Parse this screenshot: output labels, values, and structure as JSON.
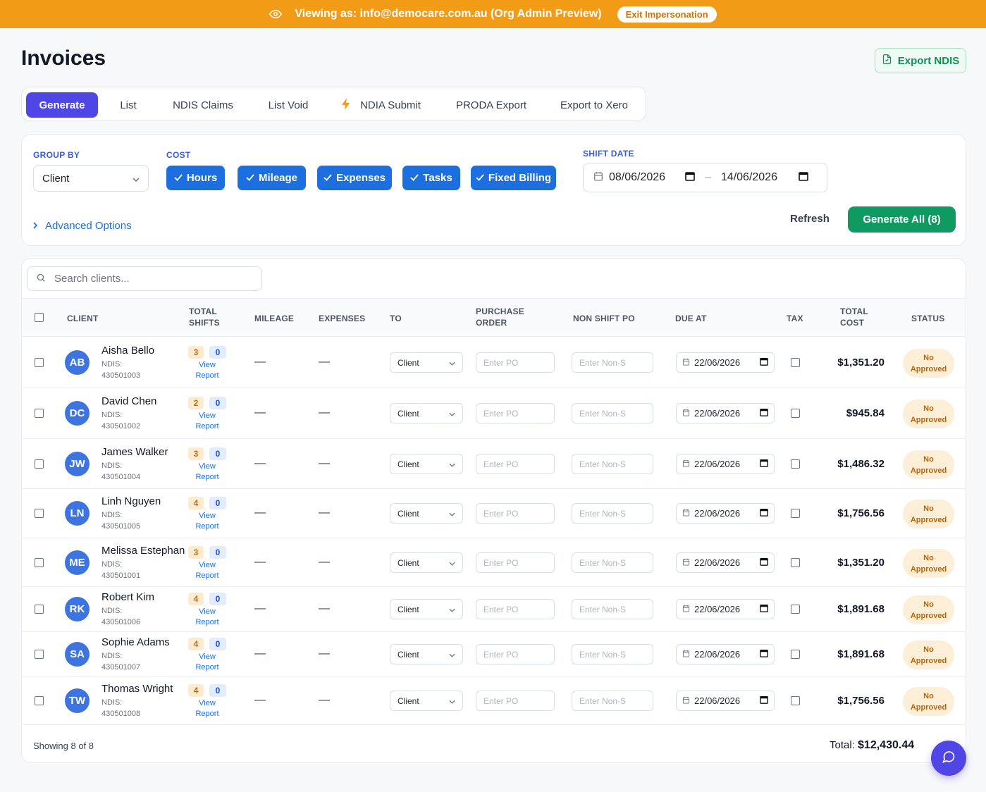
{
  "banner": {
    "text": "Viewing as: info@democare.com.au (Org Admin Preview)",
    "exit_label": "Exit Impersonation",
    "icon": "eye-icon",
    "color": "#f29b17"
  },
  "header": {
    "title": "Invoices",
    "export_label": "Export NDIS"
  },
  "tabs": [
    {
      "label": "Generate",
      "active": true
    },
    {
      "label": "List"
    },
    {
      "label": "NDIS Claims"
    },
    {
      "label": "List Void"
    },
    {
      "label": "NDIA Submit",
      "icon": "lightning-icon"
    },
    {
      "label": "PRODA Export"
    },
    {
      "label": "Export to Xero"
    }
  ],
  "filters": {
    "group_by_label": "GROUP BY",
    "group_by_value": "Client",
    "cost_label": "COST",
    "cost_options": [
      "Hours",
      "Mileage",
      "Expenses",
      "Tasks",
      "Fixed Billing"
    ],
    "shift_date_label": "SHIFT DATE",
    "date_from": "08/06/2026",
    "date_to": "14/06/2026",
    "date_separator": "–",
    "advanced_label": "Advanced Options",
    "refresh_label": "Refresh",
    "generate_all_label": "Generate All (8)"
  },
  "search": {
    "placeholder": "Search clients..."
  },
  "table": {
    "headers": {
      "client": "CLIENT",
      "total_shifts_1": "TOTAL",
      "total_shifts_2": "SHIFTS",
      "mileage": "MILEAGE",
      "expenses": "EXPENSES",
      "to": "TO",
      "po_1": "PURCHASE",
      "po_2": "ORDER",
      "non_shift_po": "NON SHIFT PO",
      "due_at": "DUE AT",
      "tax": "TAX",
      "total_cost_1": "TOTAL",
      "total_cost_2": "COST",
      "status": "STATUS"
    },
    "rows": [
      {
        "initials": "AB",
        "name": "Aisha Bello",
        "ndis_label": "NDIS:",
        "ndis": "430501003",
        "shifts": "3",
        "extra": "0",
        "view": "View",
        "report": "Report",
        "mileage": "—",
        "expenses": "—",
        "to": "Client",
        "po_placeholder": "Enter PO",
        "non_shift_placeholder": "Enter Non-S",
        "due": "22/06/2026",
        "cost": "$1,351.20",
        "status_1": "No",
        "status_2": "Approved"
      },
      {
        "initials": "DC",
        "name": "David Chen",
        "ndis_label": "NDIS:",
        "ndis": "430501002",
        "shifts": "2",
        "extra": "0",
        "view": "View",
        "report": "Report",
        "mileage": "—",
        "expenses": "—",
        "to": "Client",
        "po_placeholder": "Enter PO",
        "non_shift_placeholder": "Enter Non-S",
        "due": "22/06/2026",
        "cost": "$945.84",
        "status_1": "No",
        "status_2": "Approved"
      },
      {
        "initials": "JW",
        "name": "James Walker",
        "ndis_label": "NDIS:",
        "ndis": "430501004",
        "shifts": "3",
        "extra": "0",
        "view": "View",
        "report": "Report",
        "mileage": "—",
        "expenses": "—",
        "to": "Client",
        "po_placeholder": "Enter PO",
        "non_shift_placeholder": "Enter Non-S",
        "due": "22/06/2026",
        "cost": "$1,486.32",
        "status_1": "No",
        "status_2": "Approved"
      },
      {
        "initials": "LN",
        "name": "Linh Nguyen",
        "ndis_label": "NDIS:",
        "ndis": "430501005",
        "shifts": "4",
        "extra": "0",
        "view": "View",
        "report": "Report",
        "mileage": "—",
        "expenses": "—",
        "to": "Client",
        "po_placeholder": "Enter PO",
        "non_shift_placeholder": "Enter Non-S",
        "due": "22/06/2026",
        "cost": "$1,756.56",
        "status_1": "No",
        "status_2": "Approved"
      },
      {
        "initials": "ME",
        "name": "Melissa Estephan",
        "ndis_label": "NDIS:",
        "ndis": "430501001",
        "shifts": "3",
        "extra": "0",
        "view": "View",
        "report": "Report",
        "mileage": "—",
        "expenses": "—",
        "to": "Client",
        "po_placeholder": "Enter PO",
        "non_shift_placeholder": "Enter Non-S",
        "due": "22/06/2026",
        "cost": "$1,351.20",
        "status_1": "No",
        "status_2": "Approved"
      },
      {
        "initials": "RK",
        "name": "Robert Kim",
        "ndis_label": "NDIS:",
        "ndis": "430501006",
        "shifts": "4",
        "extra": "0",
        "view": "View",
        "report": "Report",
        "mileage": "—",
        "expenses": "—",
        "to": "Client",
        "po_placeholder": "Enter PO",
        "non_shift_placeholder": "Enter Non-S",
        "due": "22/06/2026",
        "cost": "$1,891.68",
        "status_1": "No",
        "status_2": "Approved"
      },
      {
        "initials": "SA",
        "name": "Sophie Adams",
        "ndis_label": "NDIS:",
        "ndis": "430501007",
        "shifts": "4",
        "extra": "0",
        "view": "View",
        "report": "Report",
        "mileage": "—",
        "expenses": "—",
        "to": "Client",
        "po_placeholder": "Enter PO",
        "non_shift_placeholder": "Enter Non-S",
        "due": "22/06/2026",
        "cost": "$1,891.68",
        "status_1": "No",
        "status_2": "Approved"
      },
      {
        "initials": "TW",
        "name": "Thomas Wright",
        "ndis_label": "NDIS:",
        "ndis": "430501008",
        "shifts": "4",
        "extra": "0",
        "view": "View",
        "report": "Report",
        "mileage": "—",
        "expenses": "—",
        "to": "Client",
        "po_placeholder": "Enter PO",
        "non_shift_placeholder": "Enter Non-S",
        "due": "22/06/2026",
        "cost": "$1,756.56",
        "status_1": "No",
        "status_2": "Approved"
      }
    ]
  },
  "footer": {
    "showing": "Showing 8 of 8",
    "total_label": "Total:",
    "total_value": "$12,430.44"
  },
  "colors": {
    "primary": "#4f46e5",
    "chip_blue": "#1d6fe0",
    "success": "#0f9a62",
    "warning": "#f29b17"
  }
}
